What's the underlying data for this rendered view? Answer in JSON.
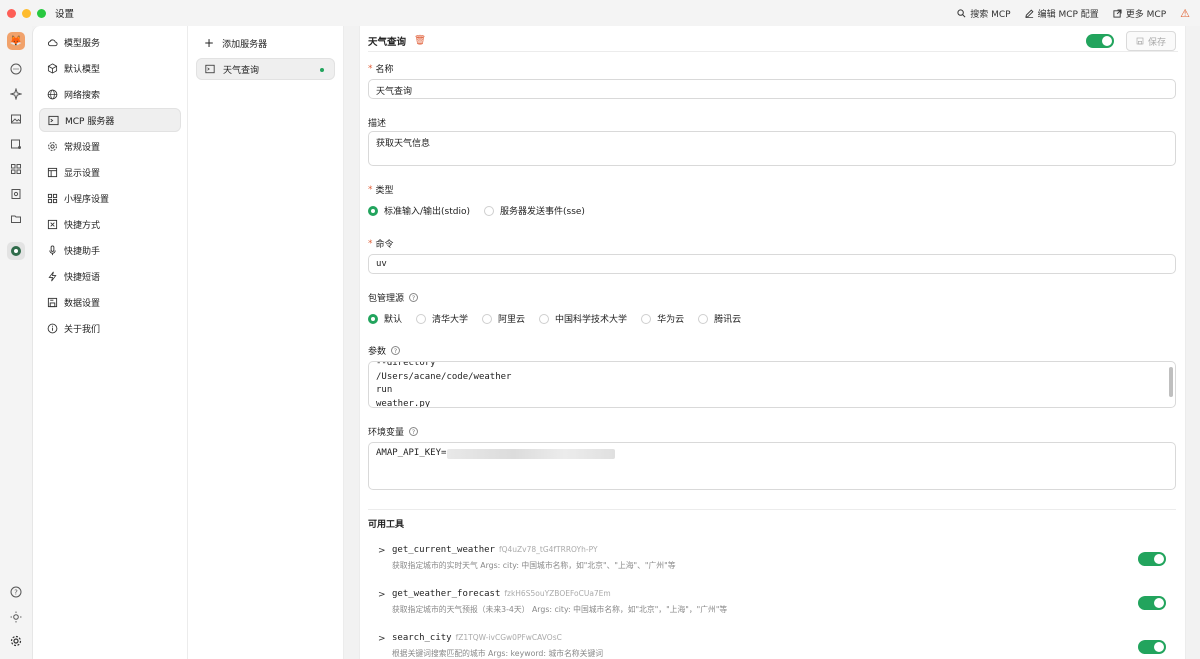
{
  "window": {
    "title": "设置",
    "actions": [
      {
        "label": "搜索 MCP",
        "icon": "search-icon"
      },
      {
        "label": "编辑 MCP 配置",
        "icon": "edit-icon"
      },
      {
        "label": "更多 MCP",
        "icon": "external-link-icon"
      }
    ]
  },
  "nav": {
    "items": [
      {
        "label": "模型服务",
        "icon": "cloud-icon"
      },
      {
        "label": "默认模型",
        "icon": "cube-icon"
      },
      {
        "label": "网络搜索",
        "icon": "globe-icon"
      },
      {
        "label": "MCP 服务器",
        "icon": "terminal-icon",
        "active": true
      },
      {
        "label": "常规设置",
        "icon": "gear-icon"
      },
      {
        "label": "显示设置",
        "icon": "layout-icon"
      },
      {
        "label": "小程序设置",
        "icon": "grid-icon"
      },
      {
        "label": "快捷方式",
        "icon": "keyboard-icon"
      },
      {
        "label": "快捷助手",
        "icon": "mic-icon"
      },
      {
        "label": "快捷短语",
        "icon": "zap-icon"
      },
      {
        "label": "数据设置",
        "icon": "save-icon"
      },
      {
        "label": "关于我们",
        "icon": "info-icon"
      }
    ]
  },
  "servers": {
    "add_label": "添加服务器",
    "items": [
      {
        "label": "天气查询",
        "active": true
      }
    ]
  },
  "form": {
    "title": "天气查询",
    "enabled": true,
    "save_label": "保存",
    "name_label": "名称",
    "name_value": "天气查询",
    "desc_label": "描述",
    "desc_value": "获取天气信息",
    "type_label": "类型",
    "type_options": [
      "标准输入/输出(stdio)",
      "服务器发送事件(sse)"
    ],
    "type_selected": 0,
    "command_label": "命令",
    "command_value": "uv",
    "registry_label": "包管理源",
    "registry_options": [
      "默认",
      "清华大学",
      "阿里云",
      "中国科学技术大学",
      "华为云",
      "腾讯云"
    ],
    "registry_selected": 0,
    "args_label": "参数",
    "args_lines": [
      "--directory",
      "/Users/acane/code/weather",
      "run",
      "weather.py"
    ],
    "env_label": "环境变量",
    "env_value": "AMAP_API_KEY="
  },
  "tools": {
    "title": "可用工具",
    "items": [
      {
        "name": "get_current_weather",
        "id": "fQ4uZv78_tG4fTRROYh-PY",
        "desc": "获取指定城市的实时天气 Args: city: 中国城市名称，如\"北京\"、\"上海\"、\"广州\"等",
        "enabled": true
      },
      {
        "name": "get_weather_forecast",
        "id": "fzkH6S5ouYZBOEFoCUa7Em",
        "desc": "获取指定城市的天气预报（未来3-4天） Args: city: 中国城市名称，如\"北京\"，\"上海\"，\"广州\"等",
        "enabled": true
      },
      {
        "name": "search_city",
        "id": "fZ1TQW-ivCGw0PFwCAVOsC",
        "desc": "根据关键词搜索匹配的城市 Args: keyword: 城市名称关键词",
        "enabled": true
      }
    ]
  },
  "colors": {
    "accent": "#22a45d",
    "danger": "#e0603a"
  }
}
